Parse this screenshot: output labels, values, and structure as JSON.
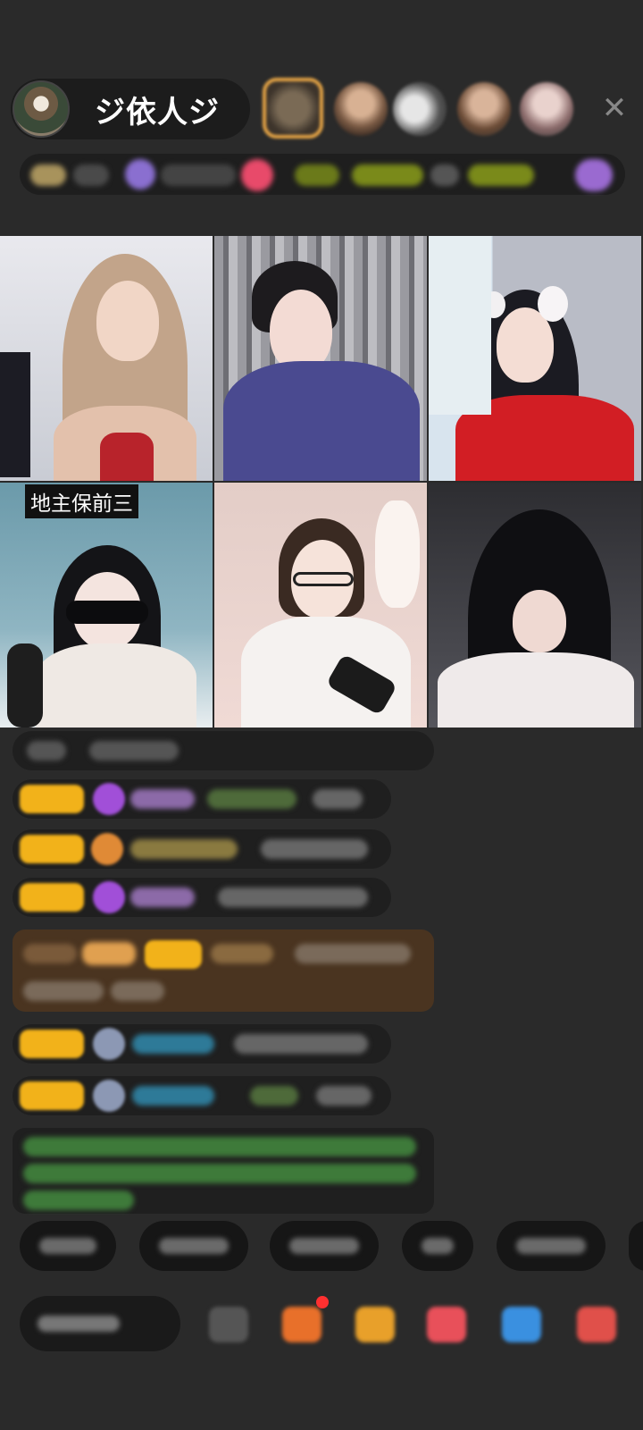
{
  "header": {
    "host_name": "ジ依人ジ",
    "viewer_avatars": [
      "viewer-1",
      "viewer-2",
      "viewer-3",
      "viewer-4",
      "viewer-5"
    ],
    "close_icon": "close-icon",
    "close_glyph": "✕"
  },
  "pk": {
    "tile_label": "地主保前三"
  },
  "colors": {
    "background": "#2a2a2a",
    "badge": "#f2b21a",
    "chat_green": "#4db04a",
    "chat_purple": "#b58ad6",
    "chat_blue": "#2e9ac2"
  }
}
